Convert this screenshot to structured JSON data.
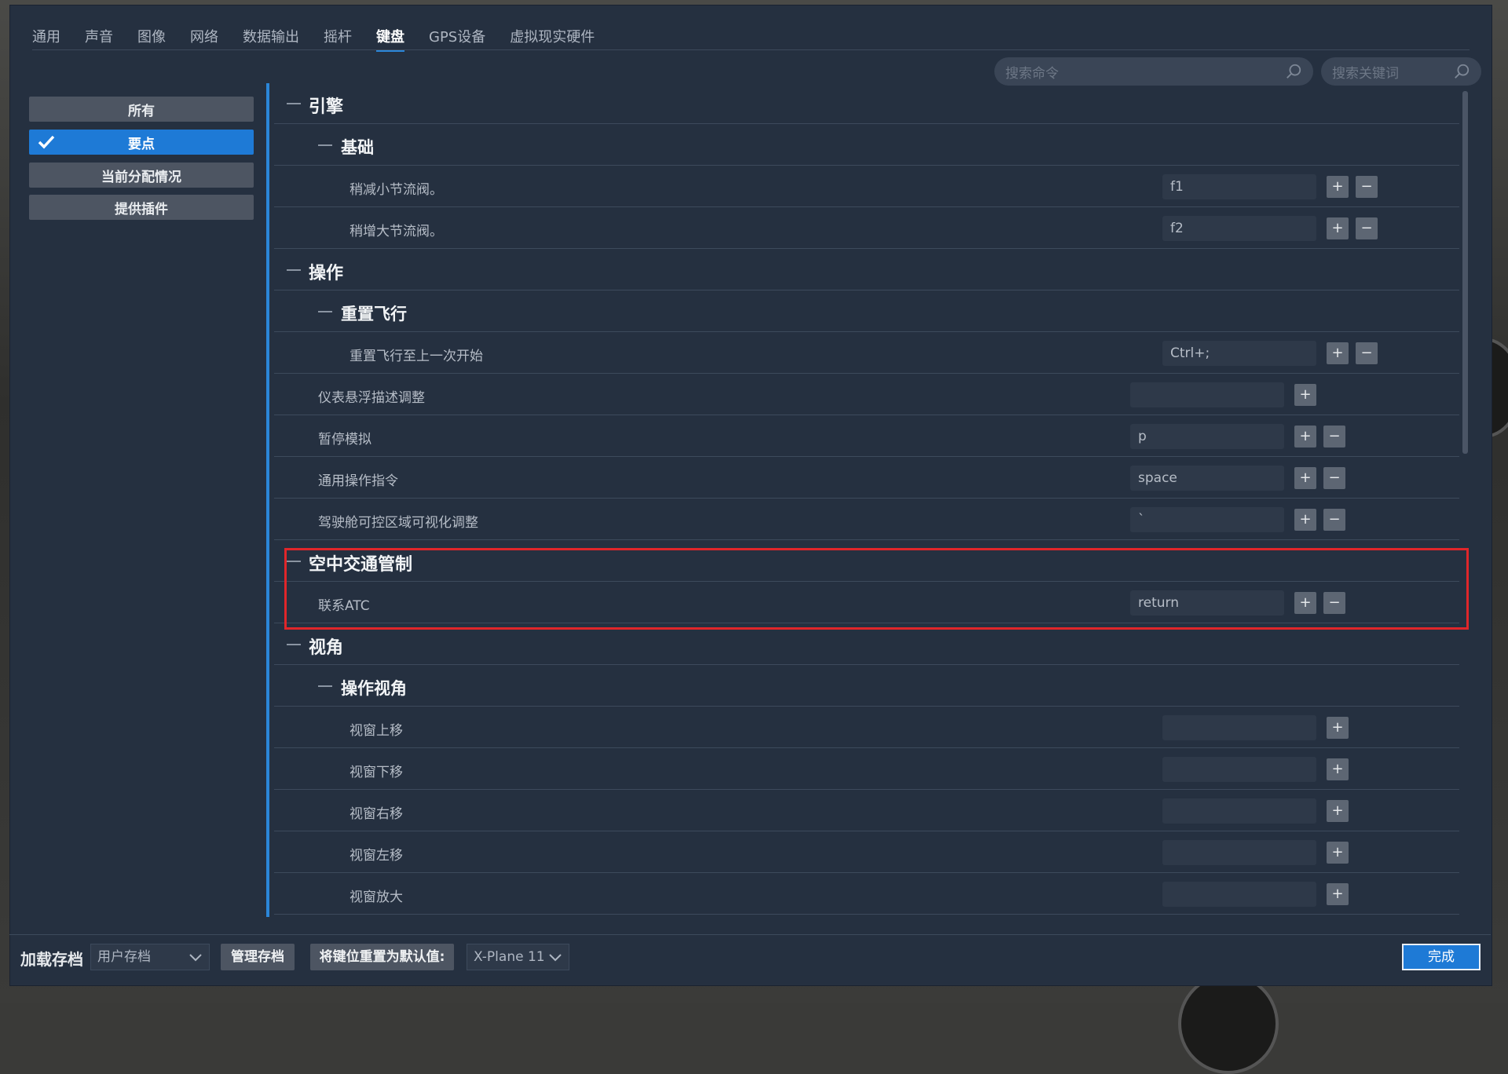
{
  "tabs": [
    "通用",
    "声音",
    "图像",
    "网络",
    "数据输出",
    "摇杆",
    "键盘",
    "GPS设备",
    "虚拟现实硬件"
  ],
  "active_tab": "键盘",
  "search": {
    "command_placeholder": "搜索命令",
    "keyword_placeholder": "搜索关键词"
  },
  "filters": {
    "all": "所有",
    "essentials": "要点",
    "current": "当前分配情况",
    "plugins": "提供插件"
  },
  "groups": {
    "engine": "引擎",
    "basic": "基础",
    "operation": "操作",
    "reset_flight": "重置飞行",
    "atc": "空中交通管制",
    "view": "视角",
    "operate_view": "操作视角"
  },
  "commands": {
    "throttle_down": {
      "label": "稍减小节流阀。",
      "key": "f1"
    },
    "throttle_up": {
      "label": "稍增大节流阀。",
      "key": "f2"
    },
    "reset_last": {
      "label": "重置飞行至上一次开始",
      "key": "Ctrl+;"
    },
    "panel_hover": {
      "label": "仪表悬浮描述调整",
      "key": ""
    },
    "pause": {
      "label": "暂停模拟",
      "key": "p"
    },
    "general_op": {
      "label": "通用操作指令",
      "key": "space"
    },
    "cockpit_vis": {
      "label": "驾驶舱可控区域可视化调整",
      "key": "`"
    },
    "contact_atc": {
      "label": "联系ATC",
      "key": "return"
    },
    "view_up": {
      "label": "视窗上移",
      "key": ""
    },
    "view_down": {
      "label": "视窗下移",
      "key": ""
    },
    "view_right": {
      "label": "视窗右移",
      "key": ""
    },
    "view_left": {
      "label": "视窗左移",
      "key": ""
    },
    "view_zoom": {
      "label": "视窗放大",
      "key": ""
    }
  },
  "buttons": {
    "plus": "+",
    "minus": "−"
  },
  "footer": {
    "load_label": "加载存档",
    "profile": "用户存档",
    "manage": "管理存档",
    "reset_default": "将键位重置为默认值:",
    "preset": "X-Plane 11",
    "done": "完成"
  },
  "colors": {
    "accent": "#1e7ad6",
    "highlight": "#e0262a",
    "panel": "#253040"
  }
}
